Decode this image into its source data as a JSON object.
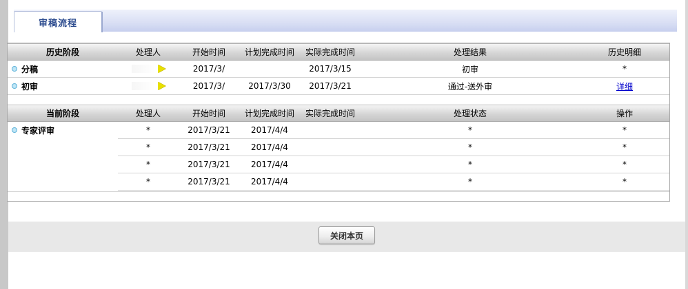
{
  "tab": {
    "title": "审稿流程"
  },
  "history": {
    "headers": [
      "历史阶段",
      "处理人",
      "开始时间",
      "计划完成时间",
      "实际完成时间",
      "处理结果",
      "历史明细"
    ],
    "rows": [
      {
        "stage": "分稿",
        "handler": "",
        "start": "2017/3/",
        "planned": "",
        "actual": "2017/3/15",
        "result": "初审",
        "detail": "*"
      },
      {
        "stage": "初审",
        "handler": "",
        "start": "2017/3/",
        "planned": "2017/3/30",
        "actual": "2017/3/21",
        "result": "通过-送外审",
        "detail": "详细"
      }
    ]
  },
  "current": {
    "headers": [
      "当前阶段",
      "处理人",
      "开始时间",
      "计划完成时间",
      "实际完成时间",
      "处理状态",
      "操作"
    ],
    "stage": "专家评审",
    "rows": [
      {
        "handler": "*",
        "start": "2017/3/21",
        "planned": "2017/4/4",
        "actual": "",
        "status": "*",
        "op": "*"
      },
      {
        "handler": "*",
        "start": "2017/3/21",
        "planned": "2017/4/4",
        "actual": "",
        "status": "*",
        "op": "*"
      },
      {
        "handler": "*",
        "start": "2017/3/21",
        "planned": "2017/4/4",
        "actual": "",
        "status": "*",
        "op": "*"
      },
      {
        "handler": "*",
        "start": "2017/3/21",
        "planned": "2017/4/4",
        "actual": "",
        "status": "*",
        "op": "*"
      }
    ]
  },
  "footer": {
    "close_label": "关闭本页"
  },
  "colors": {
    "tab_text": "#2d4c8f",
    "link": "#0000cc",
    "flag": "#e8e000",
    "dot": "#5eb2d8"
  }
}
